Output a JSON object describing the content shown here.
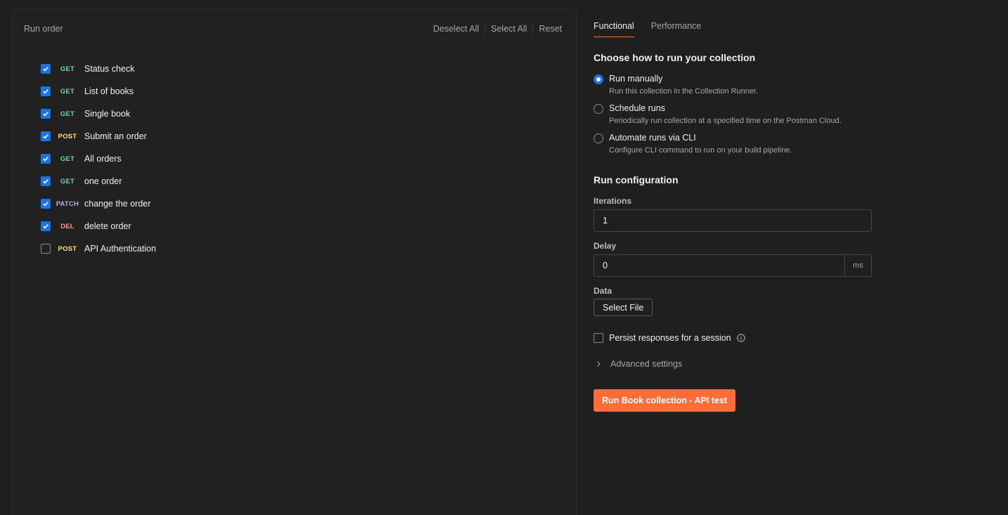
{
  "run_order": {
    "title": "Run order",
    "actions": {
      "deselect_all": "Deselect All",
      "select_all": "Select All",
      "reset": "Reset"
    },
    "requests": [
      {
        "method": "GET",
        "name": "Status check",
        "checked": true
      },
      {
        "method": "GET",
        "name": "List of books",
        "checked": true
      },
      {
        "method": "GET",
        "name": "Single book",
        "checked": true
      },
      {
        "method": "POST",
        "name": "Submit an order",
        "checked": true
      },
      {
        "method": "GET",
        "name": "All orders",
        "checked": true
      },
      {
        "method": "GET",
        "name": "one order",
        "checked": true
      },
      {
        "method": "PATCH",
        "name": "change the order",
        "checked": true
      },
      {
        "method": "DEL",
        "name": "delete order",
        "checked": true
      },
      {
        "method": "POST",
        "name": "API Authentication",
        "checked": false
      }
    ]
  },
  "method_colors": {
    "GET": "#6bdd9a",
    "POST": "#ffe47e",
    "PATCH": "#c0a8e1",
    "DEL": "#f79a8e"
  },
  "tabs": {
    "functional": "Functional",
    "performance": "Performance"
  },
  "choose": {
    "title": "Choose how to run your collection",
    "options": [
      {
        "label": "Run manually",
        "desc": "Run this collection in the Collection Runner."
      },
      {
        "label": "Schedule runs",
        "desc": "Periodically run collection at a specified time on the Postman Cloud."
      },
      {
        "label": "Automate runs via CLI",
        "desc": "Configure CLI command to run on your build pipeline."
      }
    ]
  },
  "config": {
    "title": "Run configuration",
    "iterations_label": "Iterations",
    "iterations_value": "1",
    "delay_label": "Delay",
    "delay_value": "0",
    "delay_unit": "ms",
    "data_label": "Data",
    "select_file": "Select File",
    "persist_label": "Persist responses for a session",
    "advanced_label": "Advanced settings",
    "run_button": "Run Book collection - API test"
  },
  "accent_color": "#ff6c37",
  "checkbox_color": "#1a73e8"
}
